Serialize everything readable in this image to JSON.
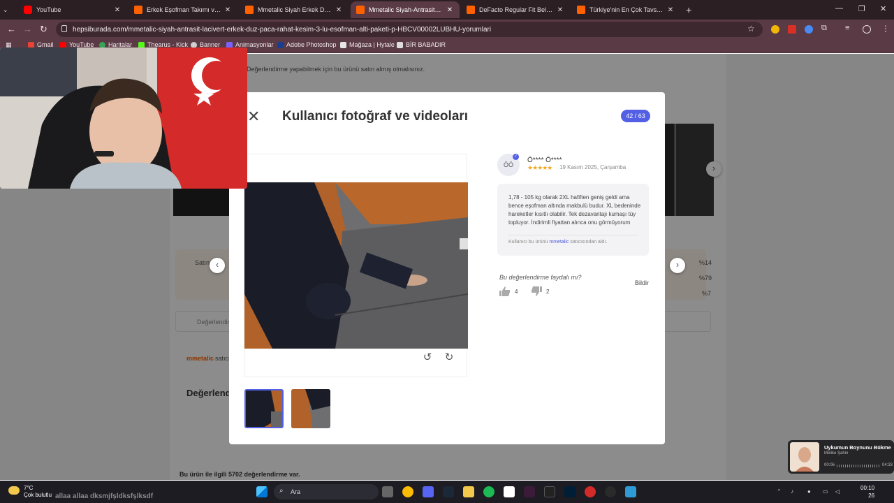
{
  "browser": {
    "tabs": [
      {
        "label": "YouTube",
        "favicon": "youtube-favicon",
        "active": false
      },
      {
        "label": "Erkek Eşofman Takımı ve Fiyatla",
        "favicon": "hepsiburada-favicon",
        "active": false
      },
      {
        "label": "Mmetalic Siyah Erkek Düz Paça",
        "favicon": "hepsiburada-favicon",
        "active": false
      },
      {
        "label": "Mmetalic Siyah-Antrasit-Laciver",
        "favicon": "hepsiburada-favicon",
        "active": true
      },
      {
        "label": "DeFacto Regular Fit Beli Bağcıklı",
        "favicon": "hepsiburada-favicon",
        "active": false
      },
      {
        "label": "Türkiye'nin En Çok Tavsiye Edile",
        "favicon": "hepsiburada-favicon",
        "active": false
      }
    ],
    "url": "hepsiburada.com/mmetalic-siyah-antrasit-lacivert-erkek-duz-paca-rahat-kesim-3-lu-esofman-alti-paketi-p-HBCV00002LUBHU-yorumlari",
    "bookmarks": [
      "Gmail",
      "YouTube",
      "Haritalar",
      "Thearus - Kick",
      "Banner",
      "Animasyonlar",
      "Adobe Photoshop",
      "Mağaza | Hytale",
      "BİR BABADIR"
    ]
  },
  "background_page": {
    "review_permission_text": "Değerlendirme yapabilmek için bu ürünü satın almış olmalısınız.",
    "seller_short": "mmetalic",
    "seller_suffix": "satıcı",
    "section_title": "Değerlendi",
    "search_placeholder": "Değerlendir",
    "percent_rows": [
      "%14",
      "%79",
      "%7"
    ],
    "total_reviews": "Bu ürün ile ilgili 5702 değerlendirme var.",
    "satin_label": "Satın"
  },
  "modal": {
    "title": "Kullanıcı fotoğraf ve videoları",
    "counter": "42 / 63",
    "review": {
      "avatar_initials": "ÖÖ",
      "user_name": "Ö**** Ö****",
      "rating": 5,
      "stars_text": "★★★★★",
      "date": "19 Kasım 2025, Çarşamba",
      "text": "1,78 - 105 kg olarak 2XL hafiften geniş geldi ama bence eşofman altında makbulü budur. XL bedeninde hareketler kısıtlı olabilir. Tek dezavantajı kumaşı tüy topluyor. İndirimli fiyattan alınca onu görmüyorum",
      "seller_prefix": "Kullanıcı bu ürünü",
      "seller_name": "mmetalic",
      "seller_suffix": "satıcısından aldı."
    },
    "helpful_question": "Bu değerlendirme faydalı mı?",
    "likes": "4",
    "dislikes": "2",
    "report_label": "Bildir"
  },
  "taskbar": {
    "temperature": "7°C",
    "weather_desc": "Çok bulutlu",
    "ticker_text": "allaa allaa dksmjfşldksfşlksdf",
    "search_label": "Ara",
    "time": "00:10",
    "date": "26"
  },
  "media_player": {
    "title": "Uykumun Boynunu Bükme",
    "artist": "Melike Şahin",
    "elapsed": "00:06",
    "duration": "04:33"
  },
  "colors": {
    "accent": "#5360e6",
    "hepsiburada_orange": "#ff6000",
    "star": "#f5a623"
  }
}
